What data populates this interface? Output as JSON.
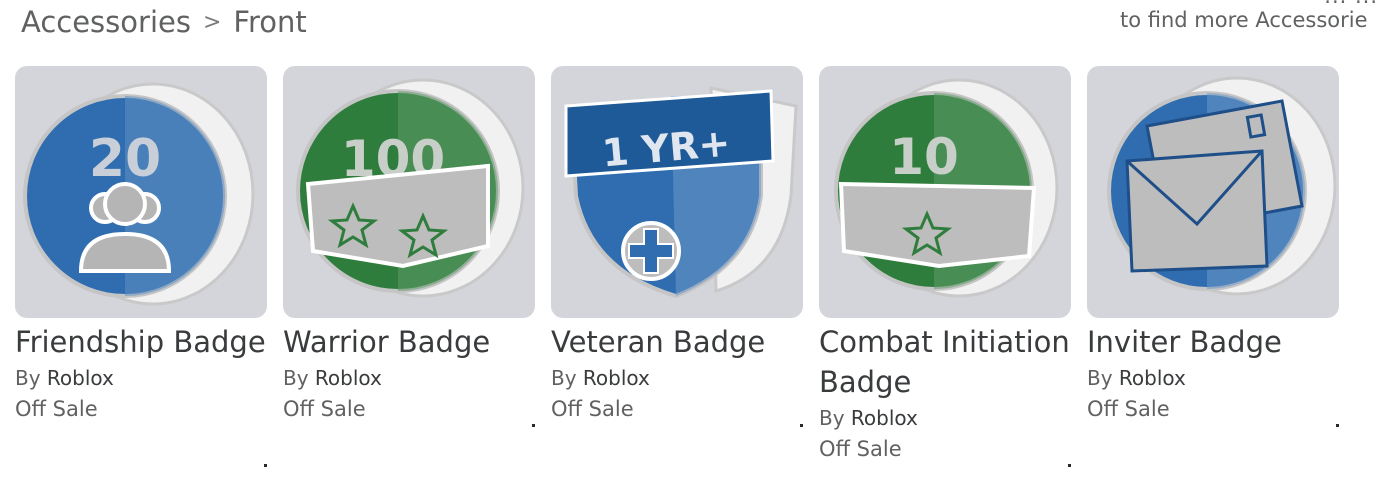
{
  "breadcrumb": {
    "parent": "Accessories",
    "separator": ">",
    "current": "Front"
  },
  "hint": {
    "line1": "...  ...",
    "line2": "to find more Accessorie"
  },
  "items": [
    {
      "name": "Friendship Badge",
      "by_label": "By",
      "creator": "Roblox",
      "price": "Off Sale",
      "badge_text": "20",
      "icon": "friendship-badge-icon"
    },
    {
      "name": "Warrior Badge",
      "by_label": "By",
      "creator": "Roblox",
      "price": "Off Sale",
      "badge_text": "100",
      "icon": "warrior-badge-icon"
    },
    {
      "name": "Veteran Badge",
      "by_label": "By",
      "creator": "Roblox",
      "price": "Off Sale",
      "badge_text": "1 YR+",
      "icon": "veteran-badge-icon"
    },
    {
      "name": "Combat Initiation Badge",
      "by_label": "By",
      "creator": "Roblox",
      "price": "Off Sale",
      "badge_text": "10",
      "icon": "combat-initiation-badge-icon"
    },
    {
      "name": "Inviter Badge",
      "by_label": "By",
      "creator": "Roblox",
      "price": "Off Sale",
      "badge_text": "",
      "icon": "inviter-badge-icon"
    }
  ],
  "colors": {
    "blue": "#2f6db0",
    "green": "#2e7d3c",
    "thumb_bg": "#d4d5db"
  }
}
